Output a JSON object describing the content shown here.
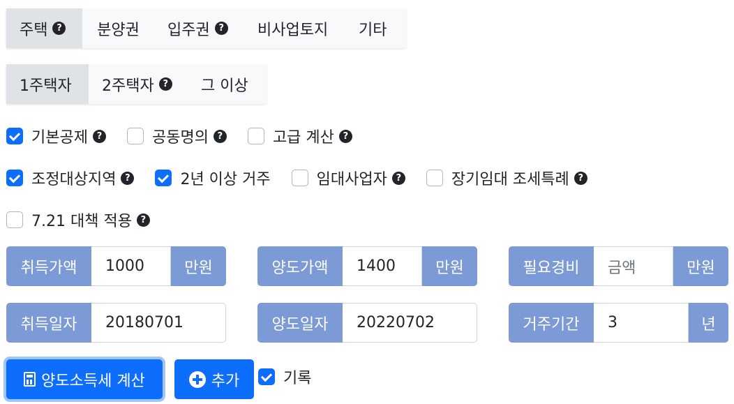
{
  "property_tabs": [
    {
      "label": "주택",
      "help": true,
      "active": true
    },
    {
      "label": "분양권",
      "help": false,
      "active": false
    },
    {
      "label": "입주권",
      "help": true,
      "active": false
    },
    {
      "label": "비사업토지",
      "help": false,
      "active": false
    },
    {
      "label": "기타",
      "help": false,
      "active": false
    }
  ],
  "owner_tabs": [
    {
      "label": "1주택자",
      "help": false,
      "active": true
    },
    {
      "label": "2주택자",
      "help": true,
      "active": false
    },
    {
      "label": "그 이상",
      "help": false,
      "active": false
    }
  ],
  "help_glyph": "?",
  "options": {
    "basic_deduction": {
      "label": "기본공제",
      "checked": true
    },
    "joint_ownership": {
      "label": "공동명의",
      "checked": false
    },
    "advanced_calc": {
      "label": "고급 계산",
      "checked": false
    },
    "adjusted_area": {
      "label": "조정대상지역",
      "checked": true
    },
    "two_year_residence": {
      "label": "2년 이상 거주",
      "checked": true
    },
    "rental_business": {
      "label": "임대사업자",
      "checked": false
    },
    "long_term_rental": {
      "label": "장기임대 조세특례",
      "checked": false
    },
    "policy_721": {
      "label": "7.21 대책 적용",
      "checked": false
    }
  },
  "fields": {
    "acquisition_price": {
      "label": "취득가액",
      "value": "1000",
      "unit": "만원"
    },
    "sale_price": {
      "label": "양도가액",
      "value": "1400",
      "unit": "만원"
    },
    "expenses": {
      "label": "필요경비",
      "placeholder": "금액",
      "unit": "만원"
    },
    "acquisition_date": {
      "label": "취득일자",
      "value": "20180701"
    },
    "sale_date": {
      "label": "양도일자",
      "value": "20220702"
    },
    "residence_period": {
      "label": "거주기간",
      "value": "3",
      "unit": "년"
    }
  },
  "actions": {
    "calculate_label": "양도소득세 계산",
    "add_label": "추가",
    "record_label": "기록",
    "record_checked": true
  },
  "colors": {
    "primary": "#0d6efd",
    "addon": "#7b9ad6",
    "active_tab": "#dfe3e8"
  }
}
